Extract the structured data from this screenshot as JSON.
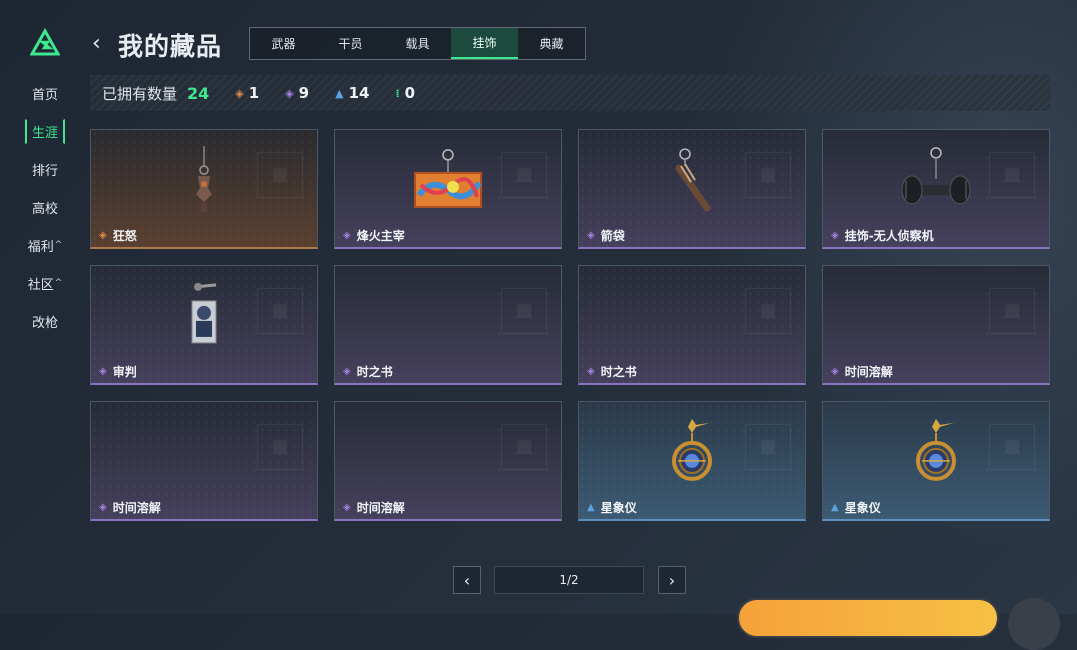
{
  "sidebar": {
    "items": [
      {
        "label": "首页",
        "caret": ""
      },
      {
        "label": "生涯",
        "caret": ""
      },
      {
        "label": "排行",
        "caret": ""
      },
      {
        "label": "高校",
        "caret": ""
      },
      {
        "label": "福利",
        "caret": "^"
      },
      {
        "label": "社区",
        "caret": "^"
      },
      {
        "label": "改枪",
        "caret": ""
      }
    ],
    "active_index": 1
  },
  "header": {
    "back_icon": "‹",
    "title": "我的藏品"
  },
  "tabs": [
    "武器",
    "干员",
    "载具",
    "挂饰",
    "典藏"
  ],
  "active_tab": "挂饰",
  "counts": {
    "label": "已拥有数量",
    "total": "24",
    "stats": [
      {
        "icon": "orange-diamond-icon",
        "glyph": "◈",
        "color": "#e08a4a",
        "value": "1"
      },
      {
        "icon": "purple-diamond-icon",
        "glyph": "◈",
        "color": "#a483e0",
        "value": "9"
      },
      {
        "icon": "blue-chevron-icon",
        "glyph": "▲",
        "color": "#5aa2e0",
        "value": "14"
      },
      {
        "icon": "green-dots-icon",
        "glyph": "⁞",
        "color": "#3ee88f",
        "value": "0"
      }
    ]
  },
  "items": [
    {
      "name": "狂怒",
      "rarity": "orange",
      "img": "keychain"
    },
    {
      "name": "烽火主宰",
      "rarity": "purple",
      "img": "crate"
    },
    {
      "name": "箭袋",
      "rarity": "purple",
      "img": "quiver"
    },
    {
      "name": "挂饰-无人侦察机",
      "rarity": "purple",
      "img": "drone"
    },
    {
      "name": "审判",
      "rarity": "purple",
      "img": "card"
    },
    {
      "name": "时之书",
      "rarity": "purple",
      "img": ""
    },
    {
      "name": "时之书",
      "rarity": "purple",
      "img": ""
    },
    {
      "name": "时间溶解",
      "rarity": "purple",
      "img": ""
    },
    {
      "name": "时间溶解",
      "rarity": "purple",
      "img": ""
    },
    {
      "name": "时间溶解",
      "rarity": "purple",
      "img": ""
    },
    {
      "name": "星象仪",
      "rarity": "blue",
      "img": "astrolabe"
    },
    {
      "name": "星象仪",
      "rarity": "blue",
      "img": "astrolabe"
    }
  ],
  "pagination": {
    "text": "1/2",
    "prev_icon": "‹",
    "next_icon": "›"
  },
  "colors": {
    "accent": "#3ee88f",
    "orange": "#e08a4a",
    "purple": "#a483e0",
    "blue": "#5aa2e0"
  }
}
